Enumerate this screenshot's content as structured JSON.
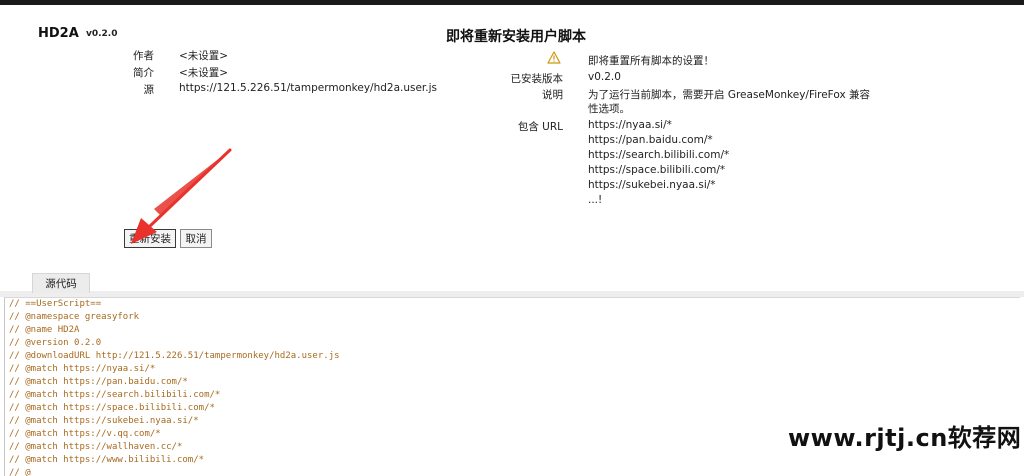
{
  "script": {
    "name": "HD2A",
    "version": "v0.2.0",
    "author_label": "作者",
    "author_value": "<未设置>",
    "desc_label": "简介",
    "desc_value": "<未设置>",
    "source_label": "源",
    "source_value": "https://121.5.226.51/tampermonkey/hd2a.user.js"
  },
  "install": {
    "heading": "即将重新安装用户脚本",
    "warning": "即将重置所有脚本的设置！",
    "installed_label": "已安装版本",
    "installed_value": "v0.2.0",
    "note_label": "说明",
    "note_value_line1": "为了运行当前脚本，需要开启 GreaseMonkey/FireFox 兼容",
    "note_value_line2": "性选项。",
    "includes_label": "包含 URL",
    "includes": [
      "https://nyaa.si/*",
      "https://pan.baidu.com/*",
      "https://search.bilibili.com/*",
      "https://space.bilibili.com/*",
      "https://sukebei.nyaa.si/*",
      "...!"
    ]
  },
  "buttons": {
    "reinstall": "重新安装",
    "cancel": "取消"
  },
  "tabs": {
    "source": "源代码"
  },
  "code_lines": [
    "// ==UserScript==",
    "// @namespace greasyfork",
    "// @name HD2A",
    "// @version 0.2.0",
    "// @downloadURL http://121.5.226.51/tampermonkey/hd2a.user.js",
    "// @match https://nyaa.si/*",
    "// @match https://pan.baidu.com/*",
    "// @match https://search.bilibili.com/*",
    "// @match https://space.bilibili.com/*",
    "// @match https://sukebei.nyaa.si/*",
    "// @match https://v.qq.com/*",
    "// @match https://wallhaven.cc/*",
    "// @match https://www.bilibili.com/*",
    "// @"
  ],
  "watermark": "www.rjtj.cn软荐网",
  "colors": {
    "arrow": "#e8322b",
    "code_text": "#a86a1f"
  }
}
